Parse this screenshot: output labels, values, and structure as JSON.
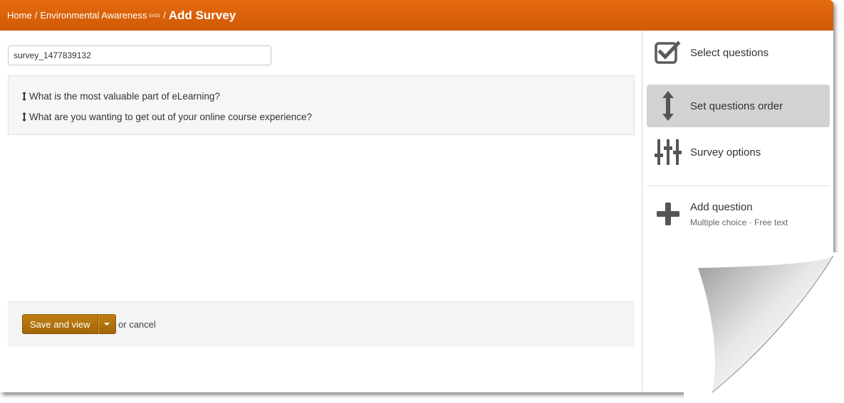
{
  "breadcrumb": {
    "home": "Home",
    "course": "Environmental Awareness",
    "course_code": "EAD1",
    "current": "Add Survey",
    "separator": "/"
  },
  "survey": {
    "name_value": "survey_1477839132"
  },
  "questions": [
    "What is the most valuable part of eLearning?",
    "What are you wanting to get out of your online course experience?"
  ],
  "actions": {
    "save_label": "Save and view",
    "or_text": "or",
    "cancel_label": "cancel"
  },
  "sidebar": {
    "select_questions": "Select questions",
    "set_order": "Set questions order",
    "survey_options": "Survey options",
    "add_question": "Add question",
    "add_question_types": "Multiple choice · Free text"
  },
  "colors": {
    "header": "#d15a05",
    "button": "#a2650a",
    "active_item": "#d2d2d2"
  },
  "icons": {
    "select": "checkbox-check-icon",
    "order": "vertical-arrows-icon",
    "options": "sliders-icon",
    "add": "plus-icon",
    "drag": "drag-handle-icon"
  }
}
